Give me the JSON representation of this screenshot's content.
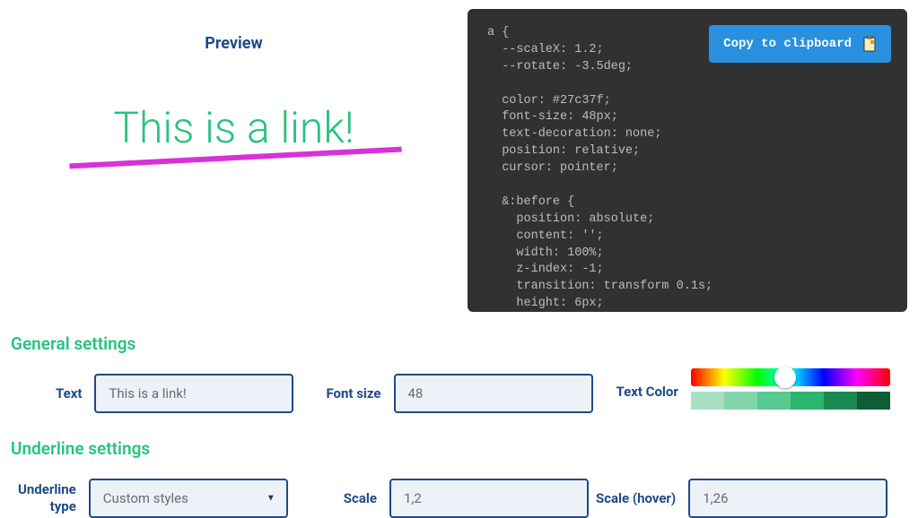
{
  "preview": {
    "title": "Preview",
    "link_text": "This is a link!"
  },
  "code": {
    "copy_button": "Copy to clipboard",
    "content": "a {\n  --scaleX: 1.2;\n  --rotate: -3.5deg;\n\n  color: #27c37f;\n  font-size: 48px;\n  text-decoration: none;\n  position: relative;\n  cursor: pointer;\n\n  &:before {\n    position: absolute;\n    content: '';\n    width: 100%;\n    z-index: -1;\n    transition: transform 0.1s;\n    height: 6px;"
  },
  "general": {
    "header": "General settings",
    "text_label": "Text",
    "text_value": "This is a link!",
    "font_size_label": "Font size",
    "font_size_value": "48",
    "text_color_label": "Text Color",
    "saturation_colors": [
      "#a9dfc3",
      "#81d5a9",
      "#56ca8f",
      "#2bb56f",
      "#1a8a52",
      "#0f5d36"
    ]
  },
  "underline": {
    "header": "Underline settings",
    "type_label_line1": "Underline",
    "type_label_line2": "type",
    "type_value": "Custom styles",
    "scale_label": "Scale",
    "scale_value": "1,2",
    "scale_hover_label": "Scale (hover)",
    "scale_hover_value": "1,26"
  }
}
